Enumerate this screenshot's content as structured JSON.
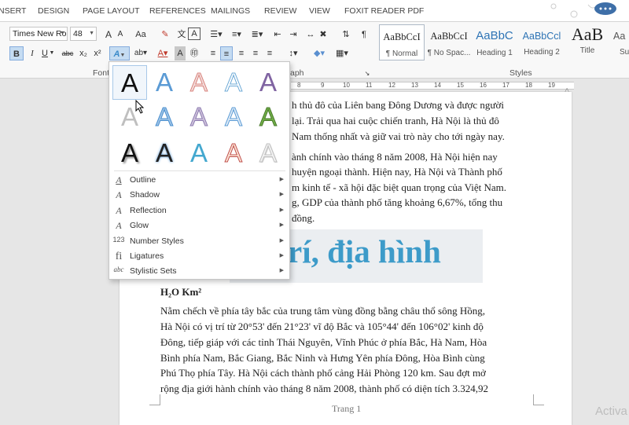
{
  "tabs": [
    "NSERT",
    "DESIGN",
    "PAGE LAYOUT",
    "REFERENCES",
    "MAILINGS",
    "REVIEW",
    "VIEW",
    "FOXIT READER PDF"
  ],
  "ribbon": {
    "font_name": "Times New Ro",
    "font_size": "48",
    "grow_font": "A",
    "shrink_font": "A",
    "change_case": "Aa",
    "bold": "B",
    "italic": "I",
    "underline": "U",
    "strikethrough": "abc",
    "subscript": "x₂",
    "superscript": "x²",
    "font_group": "Font",
    "paragraph_group": "aph",
    "styles_group": "Styles"
  },
  "styles": [
    {
      "preview": "AaBbCcI",
      "name": "¶ Normal"
    },
    {
      "preview": "AaBbCcI",
      "name": "¶ No Spac..."
    },
    {
      "preview": "AaBbC",
      "name": "Heading 1"
    },
    {
      "preview": "AaBbCcl",
      "name": "Heading 2"
    },
    {
      "preview": "AaB",
      "name": "Title"
    },
    {
      "preview": "Aa",
      "name": "Su"
    }
  ],
  "ruler": [
    "8",
    "9",
    "10",
    "11",
    "12",
    "13",
    "14",
    "15",
    "16",
    "17",
    "18",
    "19"
  ],
  "text_effects_gallery": {
    "rows": [
      [
        "A",
        "A",
        "A",
        "A",
        "A"
      ],
      [
        "A",
        "A",
        "A",
        "A",
        "A"
      ],
      [
        "A",
        "A",
        "A",
        "A",
        "A"
      ]
    ],
    "menu": [
      {
        "icon": "A",
        "label": "Outline"
      },
      {
        "icon": "A",
        "label": "Shadow"
      },
      {
        "icon": "A",
        "label": "Reflection"
      },
      {
        "icon": "A",
        "label": "Glow"
      },
      {
        "icon": "123",
        "label": "Number Styles"
      },
      {
        "icon": "fi",
        "label": "Ligatures"
      },
      {
        "icon": "abc",
        "label": "Stylistic Sets"
      }
    ]
  },
  "document": {
    "para1": [
      "h thủ đô của Liên bang Đông Dương và được người",
      "lại. Trải qua hai cuộc chiến tranh, Hà Nội là thủ đô",
      "Nam thống nhất và giữ vai trò này cho tới ngày nay."
    ],
    "para2": [
      "ành chính vào tháng 8 năm 2008, Hà Nội hiện nay",
      "huyện ngoại thành. Hiện nay, Hà Nội và Thành phố",
      "m kinh tế - xã hội đặc biệt quan trọng của Việt Nam.",
      "g, GDP của thành phố tăng khoảng 6,67%, tổng thu",
      "đồng."
    ],
    "heading": "rí, địa hình",
    "h2o": "H₂O Km²",
    "para3": [
      "Nằm chếch về phía tây bắc của trung tâm vùng đồng bằng châu thổ sông Hồng,",
      "Hà Nội có vị trí từ 20°53' đến 21°23' vĩ độ Bắc và 105°44' đến 106°02' kinh độ",
      "Đông, tiếp giáp với các tỉnh Thái Nguyên, Vĩnh Phúc ở phía Bắc, Hà Nam, Hòa",
      "Bình phía Nam, Bắc Giang, Bắc Ninh và Hưng Yên phía Đông, Hòa Bình cùng",
      "Phú Thọ phía Tây. Hà Nội cách thành phố cảng Hải Phòng 120 km. Sau đợt mở",
      "rộng địa giới hành chính vào tháng 8 năm 2008, thành phố có diện tích 3.324,92"
    ],
    "footer": "Trang 1",
    "activate": "Activa"
  }
}
